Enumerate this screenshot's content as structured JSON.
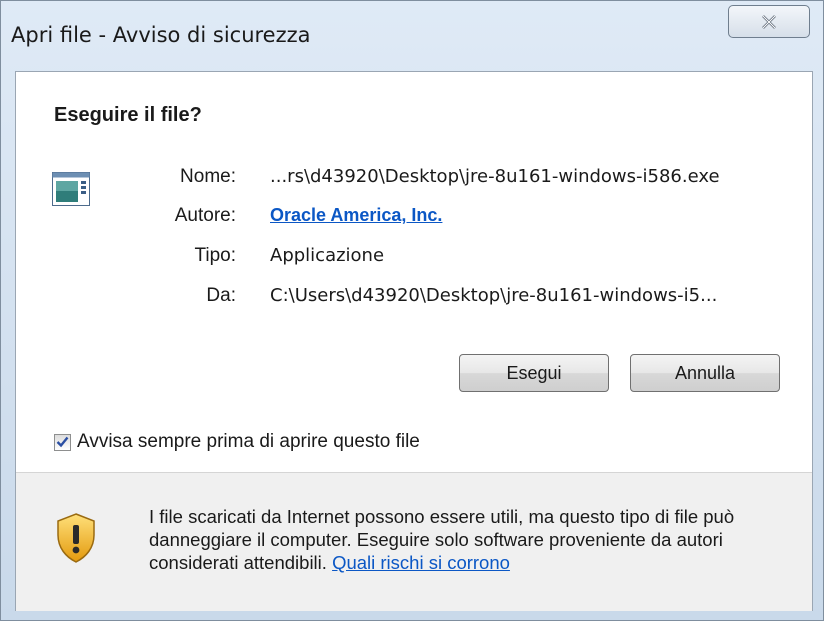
{
  "window": {
    "title": "Apri file - Avviso di sicurezza",
    "close_icon": "close-icon"
  },
  "dialog": {
    "heading": "Eseguire il file?",
    "file_icon": "application-icon",
    "fields": [
      {
        "label": "Nome:",
        "value": "...rs\\d43920\\Desktop\\jre-8u161-windows-i586.exe"
      },
      {
        "label": "Autore:",
        "value": "Oracle America, Inc."
      },
      {
        "label": "Tipo:",
        "value": "Applicazione"
      },
      {
        "label": "Da:",
        "value": "C:\\Users\\d43920\\Desktop\\jre-8u161-windows-i5..."
      }
    ],
    "run_button": "Esegui",
    "cancel_button": "Annulla",
    "checkbox": {
      "label": "Avvisa sempre prima di aprire questo file",
      "checked": true
    }
  },
  "footer": {
    "shield_icon": "security-shield-icon",
    "warning_text": "I file scaricati da Internet possono essere utili, ma questo tipo di file può danneggiare il computer. Eseguire solo software proveniente da autori considerati attendibili.",
    "link_text": "Quali rischi si corrono"
  },
  "colors": {
    "link": "#0b57c5",
    "shield": "#f0b52a"
  }
}
